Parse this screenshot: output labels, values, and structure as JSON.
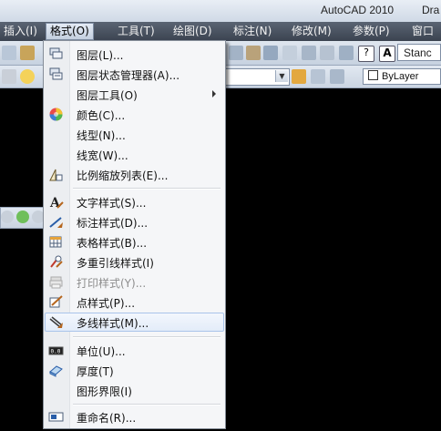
{
  "title": {
    "app": "AutoCAD 2010",
    "doc": "Dra"
  },
  "menubar": [
    {
      "label": "插入(I)",
      "name": "menu-insert"
    },
    {
      "label": "格式(O)",
      "name": "menu-format",
      "active": true
    },
    {
      "label": "工具(T)",
      "name": "menu-tools"
    },
    {
      "label": "绘图(D)",
      "name": "menu-draw"
    },
    {
      "label": "标注(N)",
      "name": "menu-dimension"
    },
    {
      "label": "修改(M)",
      "name": "menu-modify"
    },
    {
      "label": "参数(P)",
      "name": "menu-parametric"
    },
    {
      "label": "窗口(",
      "name": "menu-window"
    }
  ],
  "toolbar": {
    "text_style_value": "Stanc",
    "color_value": "ByLayer"
  },
  "format_menu": [
    {
      "label": "图层(L)...",
      "icon": "layers-icon"
    },
    {
      "label": "图层状态管理器(A)...",
      "icon": "layer-states-icon"
    },
    {
      "label": "图层工具(O)",
      "icon": "none",
      "submenu": true
    },
    {
      "label": "颜色(C)...",
      "icon": "color-wheel-icon"
    },
    {
      "label": "线型(N)...",
      "icon": "none"
    },
    {
      "label": "线宽(W)...",
      "icon": "none"
    },
    {
      "label": "比例缩放列表(E)...",
      "icon": "scale-list-icon"
    },
    {
      "label": "文字样式(S)...",
      "icon": "text-style-icon"
    },
    {
      "label": "标注样式(D)...",
      "icon": "dim-style-icon"
    },
    {
      "label": "表格样式(B)...",
      "icon": "table-style-icon"
    },
    {
      "label": "多重引线样式(I)",
      "icon": "multileader-style-icon"
    },
    {
      "label": "打印样式(Y)...",
      "icon": "plot-style-icon",
      "disabled": true
    },
    {
      "label": "点样式(P)...",
      "icon": "point-style-icon"
    },
    {
      "label": "多线样式(M)...",
      "icon": "multiline-style-icon",
      "hover": true
    },
    {
      "label": "单位(U)...",
      "icon": "units-icon"
    },
    {
      "label": "厚度(T)",
      "icon": "thickness-icon"
    },
    {
      "label": "图形界限(I)",
      "icon": "none"
    },
    {
      "label": "重命名(R)...",
      "icon": "rename-icon"
    }
  ],
  "colors": {
    "accent_hover_border": "#a9c4ea",
    "menubar_bg": "#4a5361",
    "canvas_bg": "#000000"
  }
}
